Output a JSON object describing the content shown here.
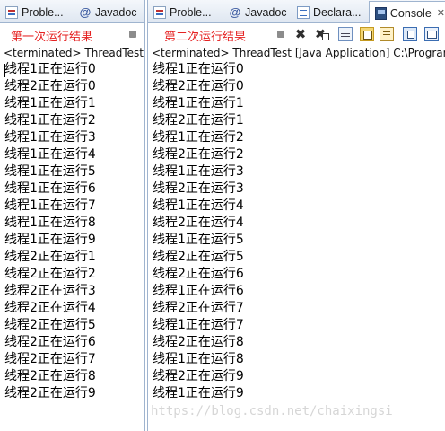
{
  "left_view": {
    "tabs": [
      {
        "label": "Proble...",
        "icon": "problems-icon"
      },
      {
        "label": "Javadoc",
        "icon": "javadoc-icon"
      }
    ],
    "caption": "第一次运行结果",
    "status": "<terminated> ThreadTest [Java Application] C:\\Program",
    "lines": [
      "线程1正在运行0",
      "线程2正在运行0",
      "线程1正在运行1",
      "线程1正在运行2",
      "线程1正在运行3",
      "线程1正在运行4",
      "线程1正在运行5",
      "线程1正在运行6",
      "线程1正在运行7",
      "线程1正在运行8",
      "线程1正在运行9",
      "线程2正在运行1",
      "线程2正在运行2",
      "线程2正在运行3",
      "线程2正在运行4",
      "线程2正在运行5",
      "线程2正在运行6",
      "线程2正在运行7",
      "线程2正在运行8",
      "线程2正在运行9"
    ]
  },
  "right_view": {
    "tabs": [
      {
        "label": "Proble...",
        "icon": "problems-icon"
      },
      {
        "label": "Javadoc",
        "icon": "javadoc-icon"
      },
      {
        "label": "Declara...",
        "icon": "declaration-icon"
      },
      {
        "label": "Console",
        "icon": "console-icon",
        "active": true
      }
    ],
    "close_glyph": "✕",
    "caption": "第二次运行结果",
    "status": "<terminated> ThreadTest [Java Application] C:\\Program",
    "lines": [
      "线程1正在运行0",
      "线程2正在运行0",
      "线程1正在运行1",
      "线程2正在运行1",
      "线程1正在运行2",
      "线程2正在运行2",
      "线程1正在运行3",
      "线程2正在运行3",
      "线程1正在运行4",
      "线程2正在运行4",
      "线程1正在运行5",
      "线程2正在运行5",
      "线程2正在运行6",
      "线程1正在运行6",
      "线程2正在运行7",
      "线程1正在运行7",
      "线程2正在运行8",
      "线程1正在运行8",
      "线程2正在运行9",
      "线程1正在运行9"
    ]
  },
  "watermark": "https://blog.csdn.net/chaixingsi"
}
